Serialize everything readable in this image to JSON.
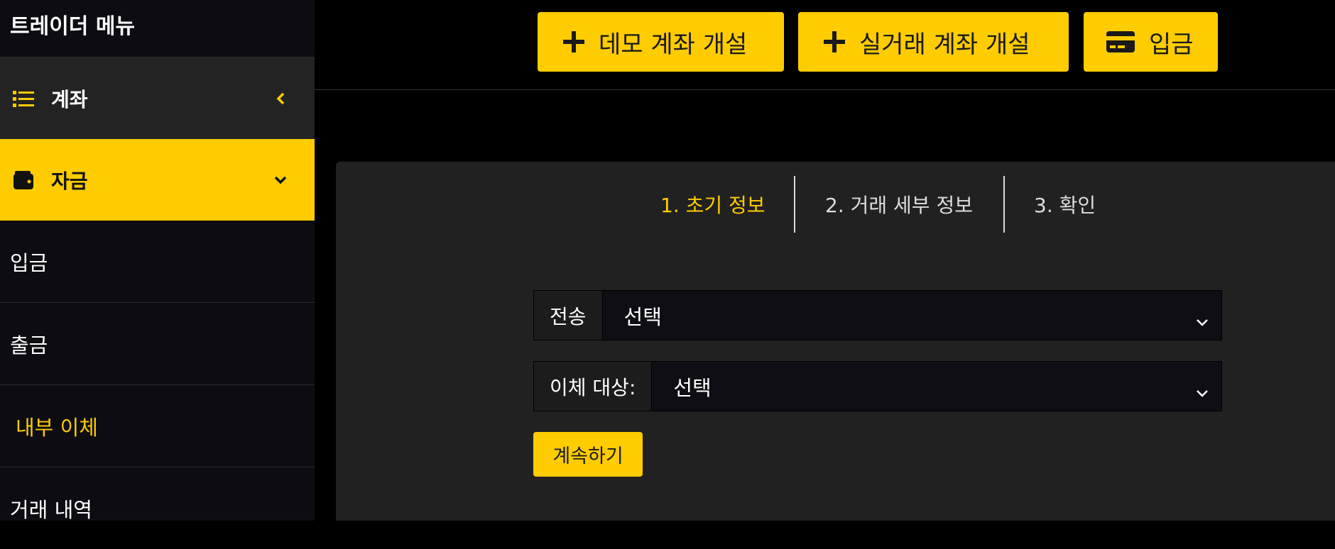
{
  "sidebar": {
    "title": "트레이더 메뉴",
    "accounts_label": "계좌",
    "funds_label": "자금",
    "items": [
      {
        "label": "입금"
      },
      {
        "label": "출금"
      },
      {
        "label": "내부 이체"
      },
      {
        "label": "거래 내역"
      }
    ]
  },
  "topbar": {
    "demo_label": "데모 계좌 개설",
    "real_label": "실거래 계좌 개설",
    "deposit_label": "입금"
  },
  "steps": {
    "s1": "1.  초기 정보",
    "s2": "2. 거래 세부 정보",
    "s3": "3. 확인"
  },
  "form": {
    "transfer_label": "전송",
    "transfer_value": "선택",
    "target_label": "이체 대상:",
    "target_value": "선택",
    "continue_label": "계속하기"
  },
  "colors": {
    "accent": "#ffcc00",
    "panel": "#212121",
    "sidebar": "#0c0c12"
  },
  "icons": [
    "list-icon",
    "chevron-left-icon",
    "wallet-icon",
    "chevron-down-icon",
    "plus-icon",
    "credit-card-icon"
  ]
}
